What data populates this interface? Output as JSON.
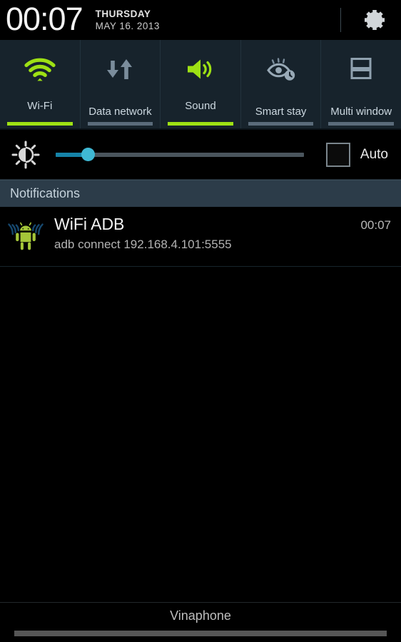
{
  "statusbar": {
    "clock": "00:07",
    "day_of_week": "THURSDAY",
    "date": "MAY 16. 2013",
    "settings_icon": "gear-icon"
  },
  "quick_settings": {
    "active_color": "#9ee114",
    "inactive_color": "#5a6b7a",
    "panel_color": "#17232c",
    "toggles": [
      {
        "label": "Wi-Fi",
        "icon": "wifi-icon",
        "active": true,
        "lines": 1
      },
      {
        "label": "Data network",
        "icon": "data-network-icon",
        "active": false,
        "lines": 2
      },
      {
        "label": "Sound",
        "icon": "sound-icon",
        "active": true,
        "lines": 1
      },
      {
        "label": "Smart stay",
        "icon": "smart-stay-icon",
        "active": false,
        "lines": 2
      },
      {
        "label": "Multi window",
        "icon": "multi-window-icon",
        "active": false,
        "lines": 2
      }
    ]
  },
  "brightness": {
    "icon": "brightness-icon",
    "value_percent": 13,
    "fill_color": "#1683a8",
    "thumb_color": "#3fb8d4",
    "auto_label": "Auto",
    "auto_checked": false
  },
  "notifications": {
    "header": "Notifications",
    "items": [
      {
        "icon": "wifi-adb-android-icon",
        "title": "WiFi ADB",
        "text": "adb connect 192.168.4.101:5555",
        "time": "00:07"
      }
    ]
  },
  "bottom": {
    "carrier": "Vinaphone",
    "handle": "drag-handle"
  }
}
